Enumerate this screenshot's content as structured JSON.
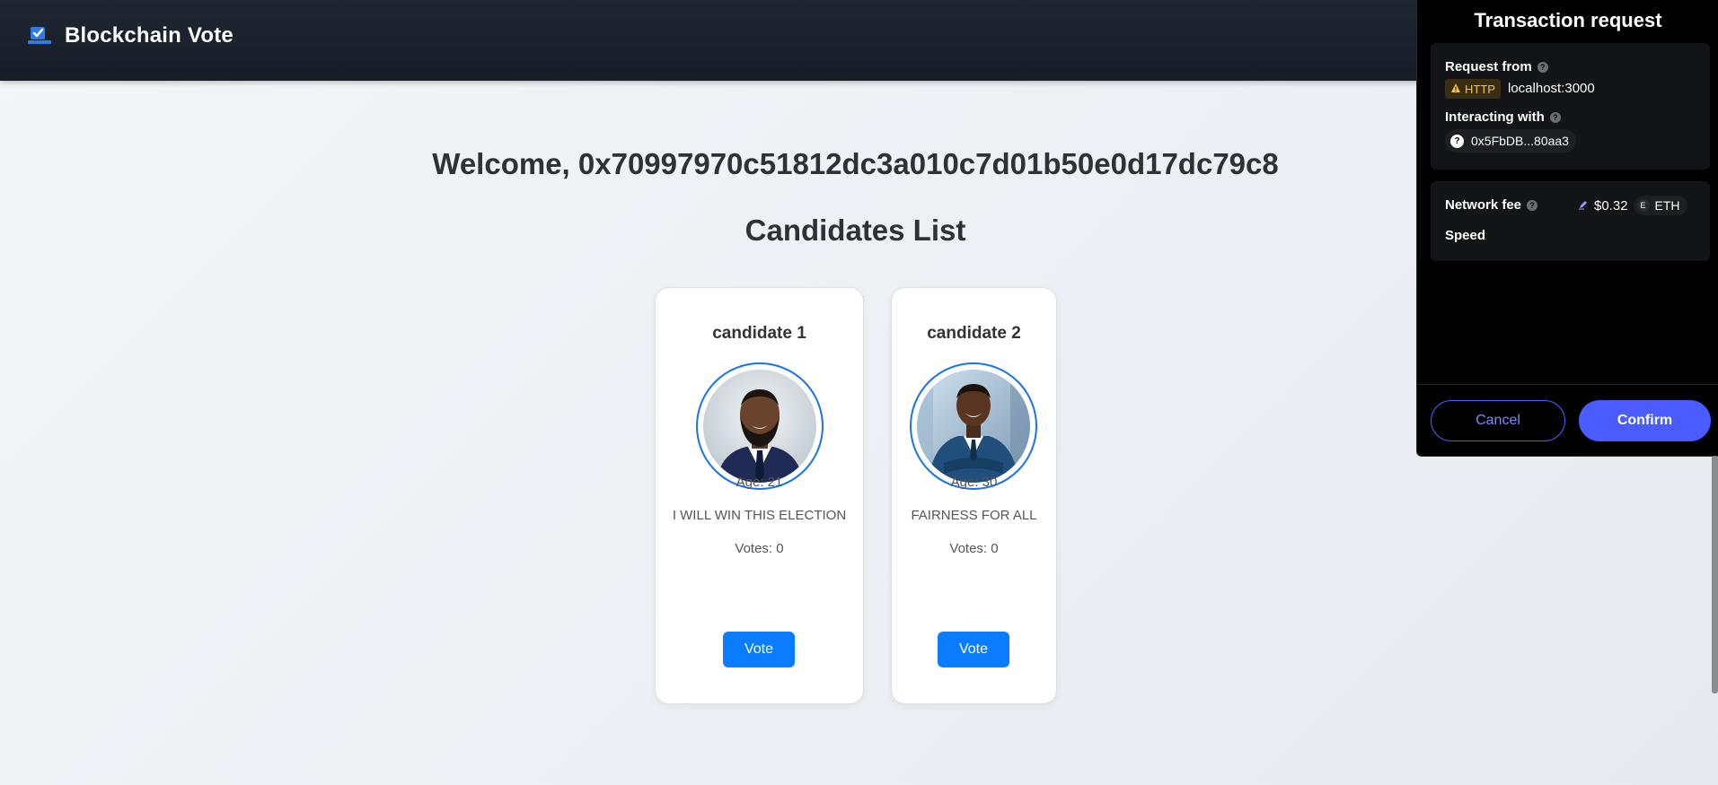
{
  "header": {
    "title": "Blockchain Vote",
    "icon": "ballot-box-icon"
  },
  "main": {
    "welcome": "Welcome, 0x70997970c51812dc3a010c7d01b50e0d17dc79c8",
    "list_title": "Candidates List",
    "candidates": [
      {
        "name": "candidate 1",
        "age": "Age: 21",
        "slogan": "I WILL WIN THIS ELECTION",
        "votes": "Votes: 0",
        "vote_label": "Vote"
      },
      {
        "name": "candidate 2",
        "age": "Age: 30",
        "slogan": "FAIRNESS FOR ALL",
        "votes": "Votes: 0",
        "vote_label": "Vote"
      }
    ]
  },
  "wallet": {
    "title": "Transaction request",
    "request_from_label": "Request from",
    "http_badge": "HTTP",
    "origin": "localhost:3000",
    "interacting_label": "Interacting with",
    "contract": "0x5FbDB...80aa3",
    "network_fee_label": "Network fee",
    "fee_amount": "$0.32",
    "currency": "ETH",
    "currency_glyph": "E",
    "speed_label": "Speed",
    "cancel_label": "Cancel",
    "confirm_label": "Confirm"
  },
  "colors": {
    "accent": "#0a7cff",
    "wallet_accent": "#4a5cff",
    "header_bg": "#1a212c",
    "warning": "#f2c14e"
  }
}
